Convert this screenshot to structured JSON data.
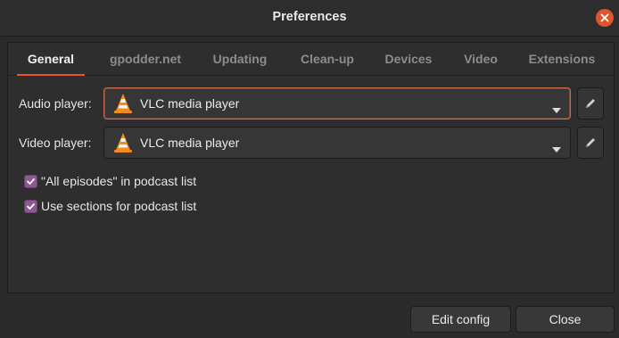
{
  "window": {
    "title": "Preferences",
    "close_icon": "close-icon",
    "close_color": "#e0552b"
  },
  "tabs": [
    {
      "label": "General",
      "active": true
    },
    {
      "label": "gpodder.net",
      "active": false
    },
    {
      "label": "Updating",
      "active": false
    },
    {
      "label": "Clean-up",
      "active": false
    },
    {
      "label": "Devices",
      "active": false
    },
    {
      "label": "Video",
      "active": false
    },
    {
      "label": "Extensions",
      "active": false
    }
  ],
  "general": {
    "audio_player": {
      "label": "Audio player:",
      "value": "VLC media player",
      "icon": "vlc-cone-icon",
      "edit_icon": "pencil-icon"
    },
    "video_player": {
      "label": "Video player:",
      "value": "VLC media player",
      "icon": "vlc-cone-icon",
      "edit_icon": "pencil-icon"
    },
    "checkboxes": [
      {
        "label": "\"All episodes\" in podcast list",
        "checked": true
      },
      {
        "label": "Use sections for podcast list",
        "checked": true
      }
    ]
  },
  "footer": {
    "edit_config_label": "Edit config",
    "close_label": "Close"
  },
  "colors": {
    "accent": "#e9541f",
    "checkbox": "#8a5a90",
    "background": "#2b2b2b"
  }
}
